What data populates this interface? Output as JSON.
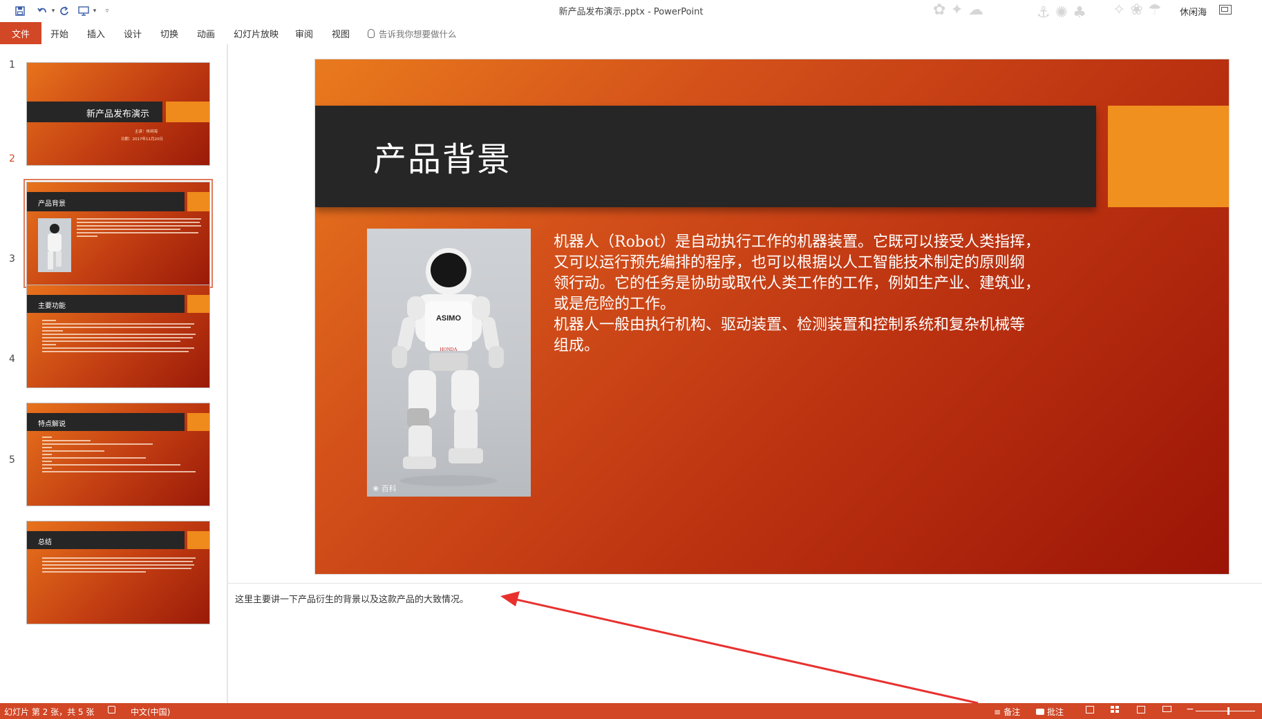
{
  "window": {
    "title": "新产品发布演示.pptx  -  PowerPoint",
    "user": "休闲海"
  },
  "ribbon": {
    "file": "文件",
    "tabs": [
      "开始",
      "插入",
      "设计",
      "切换",
      "动画",
      "幻灯片放映",
      "审阅",
      "视图"
    ],
    "tell_me": "告诉我你想要做什么"
  },
  "thumbnails": [
    {
      "num": "1",
      "title": "新产品发布演示",
      "sub1": "主讲：休闲海",
      "sub2": "日期：2017年11月20日"
    },
    {
      "num": "2",
      "title": "产品背景"
    },
    {
      "num": "3",
      "title": "主要功能"
    },
    {
      "num": "4",
      "title": "特点解说"
    },
    {
      "num": "5",
      "title": "总结"
    }
  ],
  "slide": {
    "title": "产品背景",
    "body": [
      "机器人（Robot）是自动执行工作的机器装置。它既可以接受人类指挥，",
      "又可以运行预先编排的程序，也可以根据以人工智能技术制定的原则纲",
      "领行动。它的任务是协助或取代人类工作的工作，例如生产业、建筑业，",
      "或是危险的工作。",
      "机器人一般由执行机构、驱动装置、检测装置和控制系统和复杂机械等",
      "组成。"
    ],
    "photo_text": "ASIMO",
    "photo_brand": "HONDA",
    "photo_watermark": "百科"
  },
  "notes": {
    "text": "这里主要讲一下产品衍生的背景以及这款产品的大致情况。"
  },
  "status": {
    "slide_info": "幻灯片 第 2 张，共 5 张",
    "language": "中文(中国)",
    "notes_btn": "备注",
    "comments_btn": "批注"
  },
  "colors": {
    "accent": "#d24726",
    "slide_orange": "#f0901e",
    "slide_dark": "#262626",
    "annotation_arrow": "#e8312f"
  }
}
